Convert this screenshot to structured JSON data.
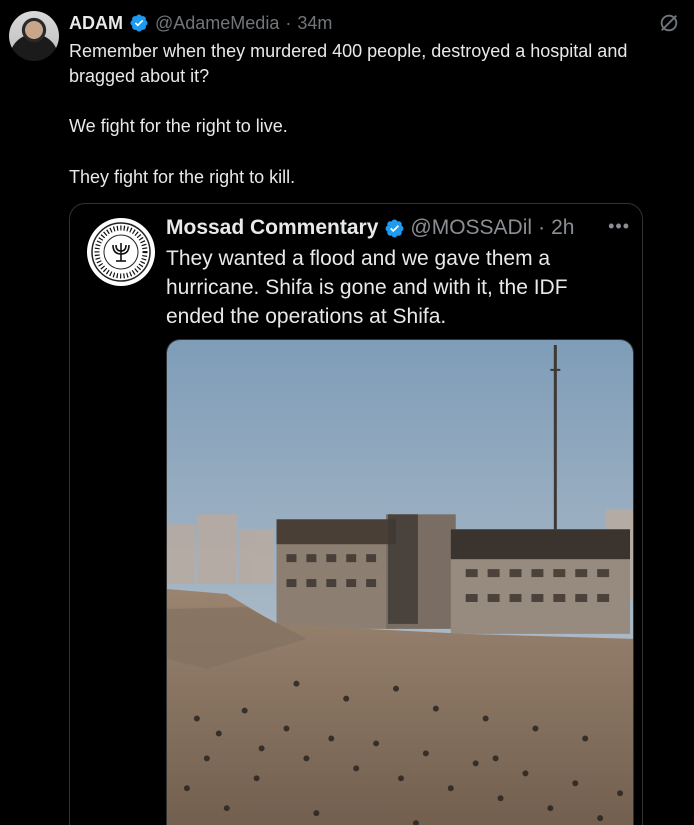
{
  "tweet": {
    "author": {
      "name": "ADAM",
      "handle": "@AdameMedia",
      "separator": "·",
      "time": "34m",
      "verified_color": "#1d9bf0"
    },
    "lines": [
      "Remember when they murdered 400 people, destroyed a hospital and bragged about it?",
      "We fight for the right to live.",
      "They fight for the right to kill."
    ],
    "icons": {
      "grok": "grok-icon",
      "verified": "verified-badge-icon"
    }
  },
  "quote": {
    "author": {
      "name": "Mossad Commentary",
      "handle": "@MOSSADil",
      "separator": "·",
      "time": "2h"
    },
    "more": "•••",
    "text": "They wanted a flood and we gave them a hurricane. Shifa is gone and with it, the IDF ended the operations at Shifa.",
    "media": {
      "icon": "photo-destroyed-buildings-crowd"
    }
  },
  "colors": {
    "background": "#000000",
    "text": "#e7e9ea",
    "muted": "#71767b",
    "border": "#2f3336",
    "accent": "#1d9bf0"
  }
}
